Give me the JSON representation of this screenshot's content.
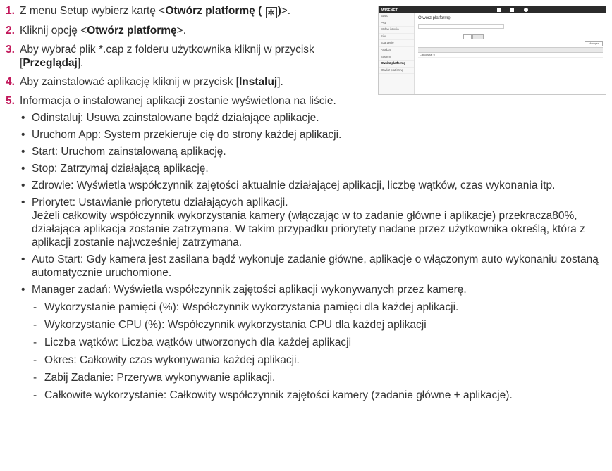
{
  "steps": [
    {
      "num": "1.",
      "pre": "Z menu Setup wybierz kartę <",
      "bold": "Otwórz platformę (",
      "icon": "gear-icon",
      "glyph": "✲",
      "bold_end": ")",
      "post": ">."
    },
    {
      "num": "2.",
      "pre": "Kliknij opcję <",
      "bold": "Otwórz platformę",
      "post": ">."
    },
    {
      "num": "3.",
      "pre": "Aby wybrać plik *.cap z folderu użytkownika kliknij w przycisk [",
      "bold": "Przeglądaj",
      "post": "]."
    },
    {
      "num": "4.",
      "pre": "Aby zainstalować aplikację kliknij w przycisk [",
      "bold": "Instaluj",
      "post": "]."
    },
    {
      "num": "5.",
      "text": "Informacja o instalowanej aplikacji zostanie wyświetlona na liście."
    }
  ],
  "bullets": [
    {
      "text": "Odinstaluj: Usuwa zainstalowane bądź działające aplikacje."
    },
    {
      "text": "Uruchom App: System przekieruje cię do strony każdej aplikacji."
    },
    {
      "text": "Start: Uruchom zainstalowaną aplikację."
    },
    {
      "text": "Stop: Zatrzymaj działającą aplikację."
    },
    {
      "text": "Zdrowie: Wyświetla współczynnik zajętości aktualnie działającej aplikacji, liczbę wątków, czas wykonania itp."
    },
    {
      "text": "Priorytet: Ustawianie priorytetu działających aplikacji.",
      "extra": "Jeżeli całkowity współczynnik wykorzystania kamery (włączając w to zadanie główne i aplikacje) przekracza80%, działająca aplikacja zostanie zatrzymana. W takim przypadku priorytety nadane przez użytkownika określą, która z aplikacji zostanie najwcześniej zatrzymana."
    },
    {
      "text": "Auto Start: Gdy kamera jest zasilana bądź wykonuje zadanie główne, aplikacje o włączonym auto wykonaniu zostaną automatycznie uruchomione."
    },
    {
      "text": "Manager zadań: Wyświetla współczynnik zajętości aplikacji wykonywanych przez kamerę."
    }
  ],
  "dashes": [
    "Wykorzystanie pamięci (%): Współczynnik wykorzystania pamięci dla każdej aplikacji.",
    "Wykorzystanie CPU (%): Współczynnik wykorzystania CPU dla każdej aplikacji",
    "Liczba wątków: Liczba wątków utworzonych dla każdej aplikacji",
    "Okres: Całkowity czas wykonywania każdej aplikacji.",
    "Zabij Zadanie: Przerywa wykonywanie aplikacji.",
    "Całkowite wykorzystanie: Całkowity współczynnik zajętości kamery (zadanie główne + aplikacje)."
  ],
  "screenshot": {
    "logo": "WISENET",
    "title": "Otwórz platformę",
    "sidebar": [
      "Basic",
      "PTZ",
      "Wideo i Audio",
      "Sieć",
      "Zdarzenie",
      "Analiza",
      "System",
      "Otwórz platformę",
      "Otwórz platformę"
    ],
    "manager_label": "Manager zadań",
    "count_label": "Całkowita: 0"
  },
  "colors": {
    "number_accent": "#c2185b",
    "topbar": "#2b2b2b"
  }
}
